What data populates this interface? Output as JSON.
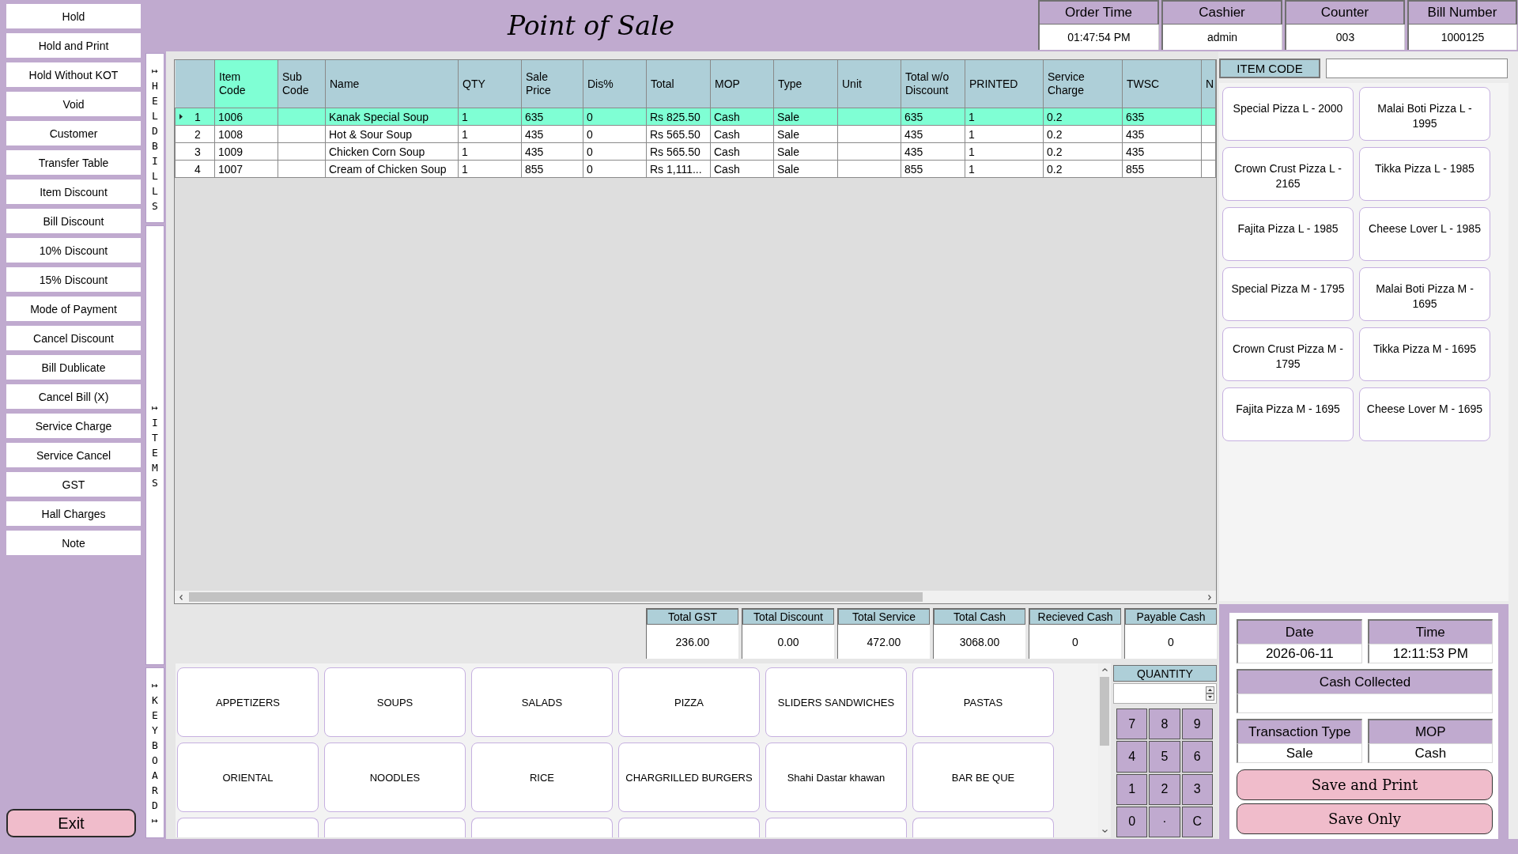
{
  "sidebar": {
    "buttons": [
      "Hold",
      "Hold and Print",
      "Hold Without KOT",
      "Void",
      "Customer",
      "Transfer Table",
      "Item Discount",
      "Bill Discount",
      "10% Discount",
      "15% Discount",
      "Mode of Payment",
      "Cancel Discount",
      "Bill Dublicate",
      "Cancel Bill (X)",
      "Service Charge",
      "Service Cancel",
      "GST",
      "Hall Charges",
      "Note"
    ],
    "exit_button": "Exit"
  },
  "header": {
    "title": "Point of Sale",
    "info": [
      {
        "label": "Order Time",
        "value": "01:47:54 PM"
      },
      {
        "label": "Cashier",
        "value": "admin"
      },
      {
        "label": "Counter",
        "value": "003"
      },
      {
        "label": "Bill Number",
        "value": "1000125"
      }
    ]
  },
  "side_panels": [
    {
      "label": "↦HELDBILLS"
    },
    {
      "label": "↦ITEMS"
    },
    {
      "label": "↦KEYBOARD↦"
    }
  ],
  "table": {
    "columns": [
      {
        "label": "Item\nCode",
        "selected": true
      },
      {
        "label": "Sub\nCode",
        "selected": false
      },
      {
        "label": "Name",
        "selected": false
      },
      {
        "label": "QTY",
        "selected": false
      },
      {
        "label": "Sale\nPrice",
        "selected": false
      },
      {
        "label": "Dis%",
        "selected": false
      },
      {
        "label": "Total",
        "selected": false
      },
      {
        "label": "MOP",
        "selected": false
      },
      {
        "label": "Type",
        "selected": false
      },
      {
        "label": "Unit",
        "selected": false
      },
      {
        "label": "Total w/o\nDiscount",
        "selected": false
      },
      {
        "label": "PRINTED",
        "selected": false
      },
      {
        "label": "Service\nCharge",
        "selected": false
      },
      {
        "label": "TWSC",
        "selected": false
      },
      {
        "label": "N",
        "selected": false
      }
    ],
    "rows": [
      {
        "number": "1",
        "selected": true,
        "cells": [
          "1006",
          null,
          "Kanak Special Soup",
          "1",
          "635",
          "0",
          "Rs 825.50",
          "Cash",
          "Sale",
          null,
          "635",
          "1",
          "0.2",
          "635"
        ]
      },
      {
        "number": "2",
        "selected": false,
        "cells": [
          "1008",
          null,
          "Hot & Sour Soup",
          "1",
          "435",
          "0",
          "Rs 565.50",
          "Cash",
          "Sale",
          null,
          "435",
          "1",
          "0.2",
          "435"
        ]
      },
      {
        "number": "3",
        "selected": false,
        "cells": [
          "1009",
          null,
          "Chicken Corn Soup",
          "1",
          "435",
          "0",
          "Rs 565.50",
          "Cash",
          "Sale",
          null,
          "435",
          "1",
          "0.2",
          "435"
        ]
      },
      {
        "number": "4",
        "selected": false,
        "cells": [
          "1007",
          null,
          "Cream of Chicken Soup",
          "1",
          "855",
          "0",
          "Rs 1,111...",
          "Cash",
          "Sale",
          null,
          "855",
          "1",
          "0.2",
          "855"
        ]
      }
    ]
  },
  "totals": [
    {
      "label": "Total GST",
      "value": "236.00"
    },
    {
      "label": "Total Discount",
      "value": "0.00"
    },
    {
      "label": "Total Service",
      "value": "472.00"
    },
    {
      "label": "Total Cash",
      "value": "3068.00"
    },
    {
      "label": "Recieved Cash",
      "value": "0"
    },
    {
      "label": "Payable Cash",
      "value": "0"
    }
  ],
  "categories": [
    {
      "kind": "category",
      "label": "APPETIZERS"
    },
    {
      "kind": "category",
      "label": "SOUPS"
    },
    {
      "kind": "category",
      "label": "SALADS"
    },
    {
      "kind": "category",
      "label": "PIZZA"
    },
    {
      "kind": "category",
      "label": "SLIDERS SANDWICHES"
    },
    {
      "kind": "category",
      "label": "PASTAS"
    },
    {
      "kind": "category",
      "label": "ORIENTAL"
    },
    {
      "kind": "category",
      "label": "NOODLES"
    },
    {
      "kind": "category",
      "label": "RICE"
    },
    {
      "kind": "category",
      "label": "CHARGRILLED BURGERS"
    },
    {
      "kind": "category",
      "label": "Shahi Dastar khawan"
    },
    {
      "kind": "category",
      "label": "BAR BE QUE"
    },
    {
      "kind": "blank"
    },
    {
      "kind": "blank"
    },
    {
      "kind": "blank"
    },
    {
      "kind": "blank"
    },
    {
      "kind": "blank"
    },
    {
      "kind": "blank"
    }
  ],
  "quantity": {
    "label": "QUANTITY",
    "keys": [
      "7",
      "8",
      "9",
      "4",
      "5",
      "6",
      "1",
      "2",
      "3",
      "0",
      "·",
      "C"
    ]
  },
  "item_code": {
    "label": "ITEM CODE"
  },
  "menu_items": [
    "Special Pizza L - 2000",
    "Malai Boti Pizza L - 1995",
    "Crown Crust Pizza L - 2165",
    "Tikka Pizza L - 1985",
    "Fajita Pizza L - 1985",
    "Cheese Lover L - 1985",
    "Special Pizza M - 1795",
    "Malai Boti Pizza M - 1695",
    "Crown Crust Pizza M - 1795",
    "Tikka Pizza M - 1695",
    "Fajita Pizza M - 1695",
    "Cheese Lover M - 1695"
  ],
  "transaction": {
    "rows": [
      {
        "fields": [
          {
            "kind": "display",
            "label": "Date",
            "value": "2026-06-11"
          },
          {
            "kind": "display",
            "label": "Time",
            "value": "12:11:53 PM"
          }
        ]
      },
      {
        "fields": [
          {
            "kind": "input",
            "label": "Cash Collected"
          }
        ]
      },
      {
        "fields": [
          {
            "kind": "display",
            "label": "Transaction Type",
            "value": "Sale"
          },
          {
            "kind": "display",
            "label": "MOP",
            "value": "Cash"
          }
        ]
      }
    ],
    "buttons": [
      "Save and Print",
      "Save Only"
    ]
  }
}
